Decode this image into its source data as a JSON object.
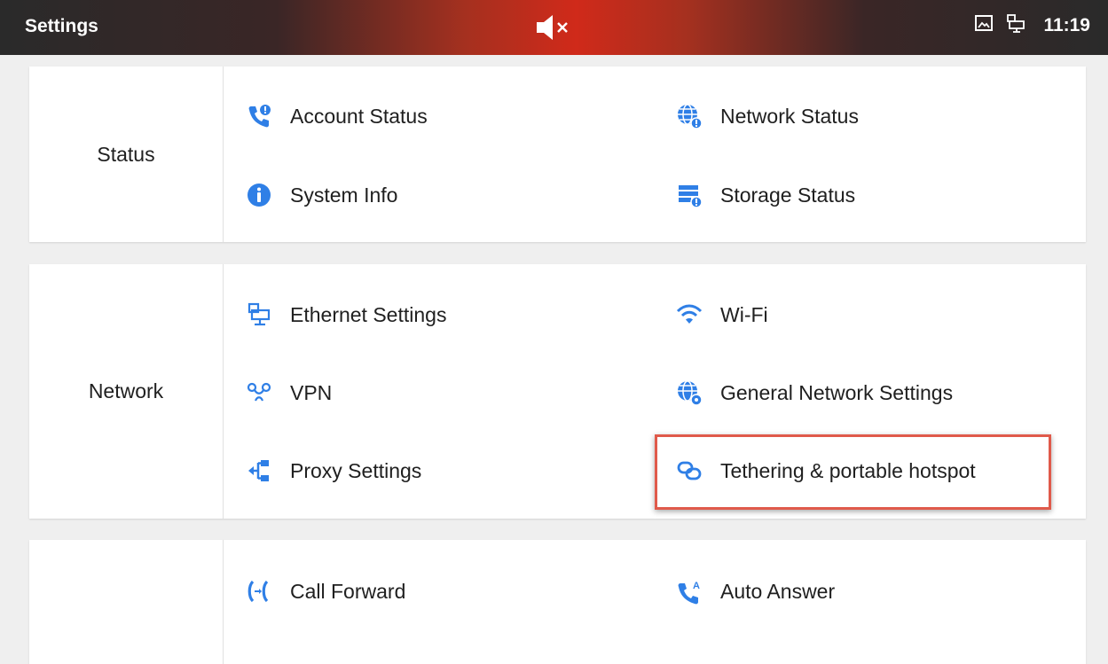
{
  "statusbar": {
    "title": "Settings",
    "time": "11:19",
    "icons": [
      "mute-icon",
      "screenshot-icon",
      "ethernet-icon"
    ]
  },
  "sections": [
    {
      "category": "Status",
      "items": [
        {
          "label": "Account Status",
          "icon": "phone-alert-icon"
        },
        {
          "label": "Network Status",
          "icon": "globe-alert-icon"
        },
        {
          "label": "System Info",
          "icon": "info-icon"
        },
        {
          "label": "Storage Status",
          "icon": "storage-alert-icon"
        }
      ]
    },
    {
      "category": "Network",
      "items": [
        {
          "label": "Ethernet Settings",
          "icon": "ethernet-icon"
        },
        {
          "label": "Wi-Fi",
          "icon": "wifi-icon"
        },
        {
          "label": "VPN",
          "icon": "vpn-icon"
        },
        {
          "label": "General Network Settings",
          "icon": "globe-gear-icon"
        },
        {
          "label": "Proxy Settings",
          "icon": "proxy-icon"
        },
        {
          "label": "Tethering & portable hotspot",
          "icon": "tethering-icon"
        }
      ]
    },
    {
      "category": "",
      "items": [
        {
          "label": "Call Forward",
          "icon": "call-forward-icon"
        },
        {
          "label": "Auto Answer",
          "icon": "auto-answer-icon"
        }
      ]
    }
  ],
  "colors": {
    "accent": "#2f7fe6",
    "highlight": "#e05a4b",
    "text": "#202020"
  }
}
